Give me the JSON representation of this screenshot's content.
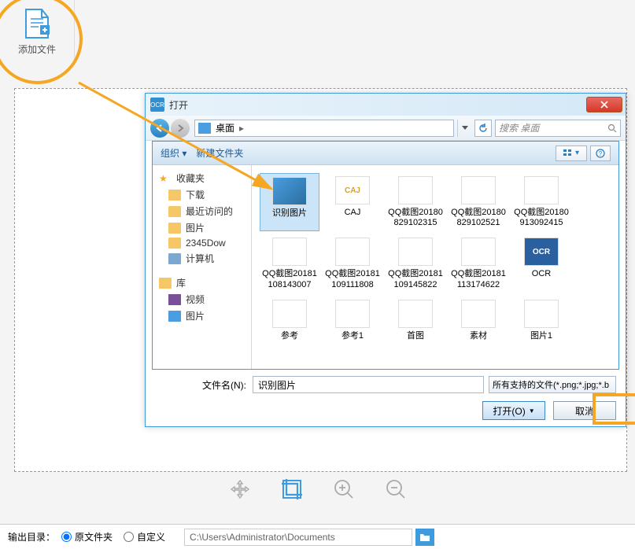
{
  "add_file": {
    "label": "添加文件"
  },
  "dialog": {
    "title": "打开",
    "nav": {
      "path": "桌面",
      "path_sep": "▸",
      "search_placeholder": "搜索 桌面"
    },
    "toolbar": {
      "organize": "组织 ▾",
      "new_folder": "新建文件夹"
    },
    "sidebar": {
      "favorites": {
        "label": "收藏夹",
        "items": [
          "下载",
          "最近访问的",
          "图片",
          "2345Dow",
          "计算机"
        ]
      },
      "libraries": {
        "label": "库",
        "items": [
          "视频",
          "图片"
        ]
      }
    },
    "files": [
      {
        "label": "识别图片",
        "thumb": "img",
        "selected": true
      },
      {
        "label": "CAJ",
        "thumb": "caj"
      },
      {
        "label": "QQ截图20180829102315",
        "thumb": "doc"
      },
      {
        "label": "QQ截图20180829102521",
        "thumb": "doc"
      },
      {
        "label": "QQ截图20180913092415",
        "thumb": "doc"
      },
      {
        "label": "QQ截图20181108143007",
        "thumb": "doc"
      },
      {
        "label": "QQ截图20181109111808",
        "thumb": "doc"
      },
      {
        "label": "QQ截图20181109145822",
        "thumb": "doc"
      },
      {
        "label": "QQ截图20181113174622",
        "thumb": "doc"
      },
      {
        "label": "OCR",
        "thumb": "ocr"
      },
      {
        "label": "参考",
        "thumb": "doc"
      },
      {
        "label": "参考1",
        "thumb": "doc"
      },
      {
        "label": "首图",
        "thumb": "doc"
      },
      {
        "label": "素材",
        "thumb": "doc"
      },
      {
        "label": "图片1",
        "thumb": "doc"
      }
    ],
    "filename": {
      "label": "文件名(N):",
      "value": "识别图片"
    },
    "filetype": "所有支持的文件(*.png;*.jpg;*.b",
    "buttons": {
      "open": "打开(O)",
      "cancel": "取消"
    }
  },
  "output": {
    "label": "输出目录：",
    "radio_original": "原文件夹",
    "radio_custom": "自定义",
    "path": "C:\\Users\\Administrator\\Documents"
  }
}
